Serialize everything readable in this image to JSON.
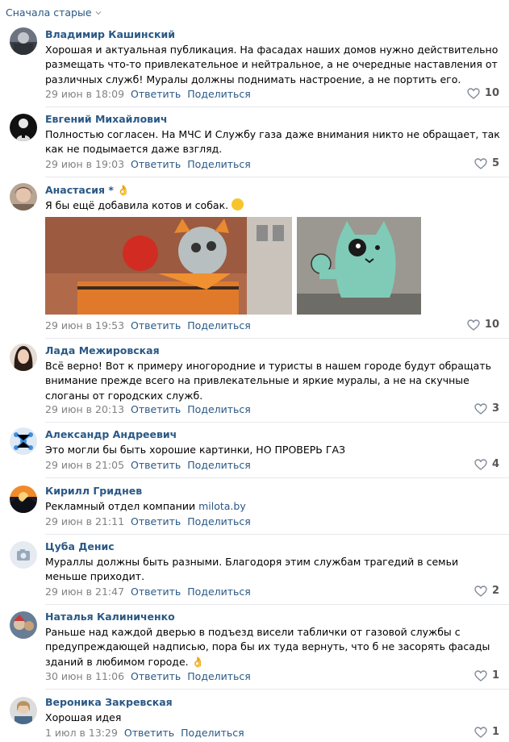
{
  "sort": {
    "label": "Сначала старые"
  },
  "actions": {
    "reply": "Ответить",
    "share": "Поделиться"
  },
  "comments": [
    {
      "author": "Владимир Кашинский",
      "text": "Хорошая и актуальная публикация. На фасадах наших домов нужно действительно размещать что-то привлекательное и нейтральное, а не очередные наставления от различных служб! Муралы должны поднимать настроение, а не портить его.",
      "date": "29 июн в 18:09",
      "likes": "10"
    },
    {
      "author": "Евгений Михайлович",
      "text": "Полностью согласен. На МЧС И Службу газа даже внимания никто не обращает, так как не подымается даже взгляд.",
      "date": "29 июн в 19:03",
      "likes": "5"
    },
    {
      "author": "Анастасия *",
      "text": "Я бы ещё добавила котов и собак.",
      "date": "29 июн в 19:53",
      "likes": "10"
    },
    {
      "author": "Лада Межировская",
      "text": "Всё верно! Вот к примеру иногородние и туристы в нашем городе будут обращать внимание прежде всего на привлекательные и яркие муралы, а не на скучные слоганы от городских служб.",
      "date": "29 июн в 20:13",
      "likes": "3"
    },
    {
      "author": "Александр Андреевич",
      "text": "Это могли бы быть хорошие картинки, НО ПРОВЕРЬ ГАЗ",
      "date": "29 июн в 21:05",
      "likes": "4"
    },
    {
      "author": "Кирилл Гриднев",
      "text": "Рекламный отдел компании",
      "link": "milota.by",
      "date": "29 июн в 21:11",
      "likes": ""
    },
    {
      "author": "Цуба Денис",
      "text": "Мураллы должны быть разными. Благодоря этим службам трагедий в семьи меньше приходит.",
      "date": "29 июн в 21:47",
      "likes": "2"
    },
    {
      "author": "Наталья Калиниченко",
      "text": "Раньше над каждой дверью в подъезд висели таблички от газовой службы с предупреждающей надписью, пора бы их туда вернуть, что б не засорять фасады зданий в любимом городе.",
      "date": "30 июн в 11:06",
      "likes": "1"
    },
    {
      "author": "Вероника Закревская",
      "text": "Хорошая идея",
      "date": "1 июл в 13:29",
      "likes": "1"
    }
  ],
  "colors": {
    "link": "#2a5885",
    "meta": "#828282",
    "divider": "#e7e8ec"
  }
}
